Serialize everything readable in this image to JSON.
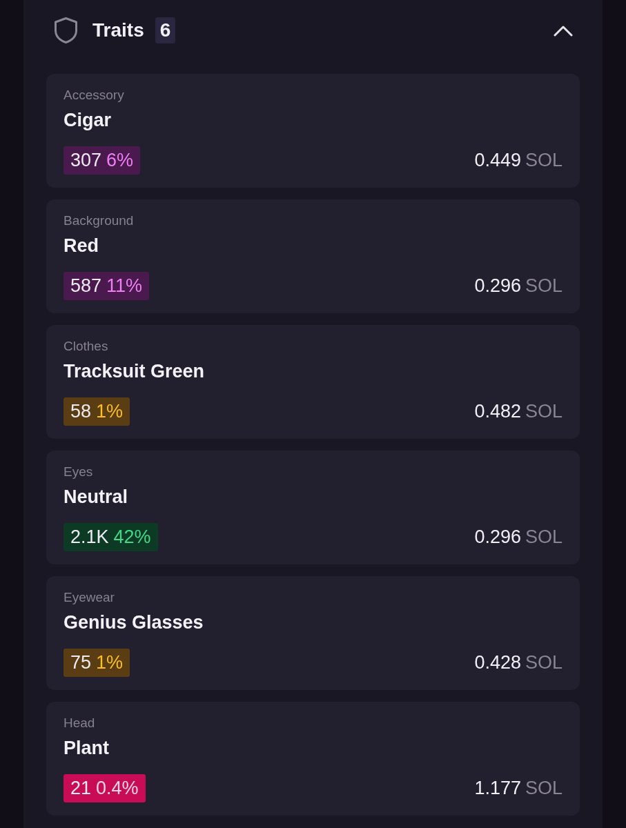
{
  "section": {
    "title": "Traits",
    "count": "6",
    "expanded": true
  },
  "traits": [
    {
      "category": "Accessory",
      "value": "Cigar",
      "count": "307",
      "percent": "6%",
      "color": "#4a1a4e",
      "price": "0.449",
      "currency": "SOL"
    },
    {
      "category": "Background",
      "value": "Red",
      "count": "587",
      "percent": "11%",
      "color": "#4a1a4e",
      "price": "0.296",
      "currency": "SOL"
    },
    {
      "category": "Clothes",
      "value": "Tracksuit Green",
      "count": "58",
      "percent": "1%",
      "color": "#5a3d12",
      "price": "0.482",
      "currency": "SOL"
    },
    {
      "category": "Eyes",
      "value": "Neutral",
      "count": "2.1K",
      "percent": "42%",
      "color": "#0d3a24",
      "price": "0.296",
      "currency": "SOL"
    },
    {
      "category": "Eyewear",
      "value": "Genius Glasses",
      "count": "75",
      "percent": "1%",
      "color": "#5a3d12",
      "price": "0.428",
      "currency": "SOL"
    },
    {
      "category": "Head",
      "value": "Plant",
      "count": "21",
      "percent": "0.4%",
      "color": "#c80c55",
      "price": "1.177",
      "currency": "SOL"
    }
  ]
}
